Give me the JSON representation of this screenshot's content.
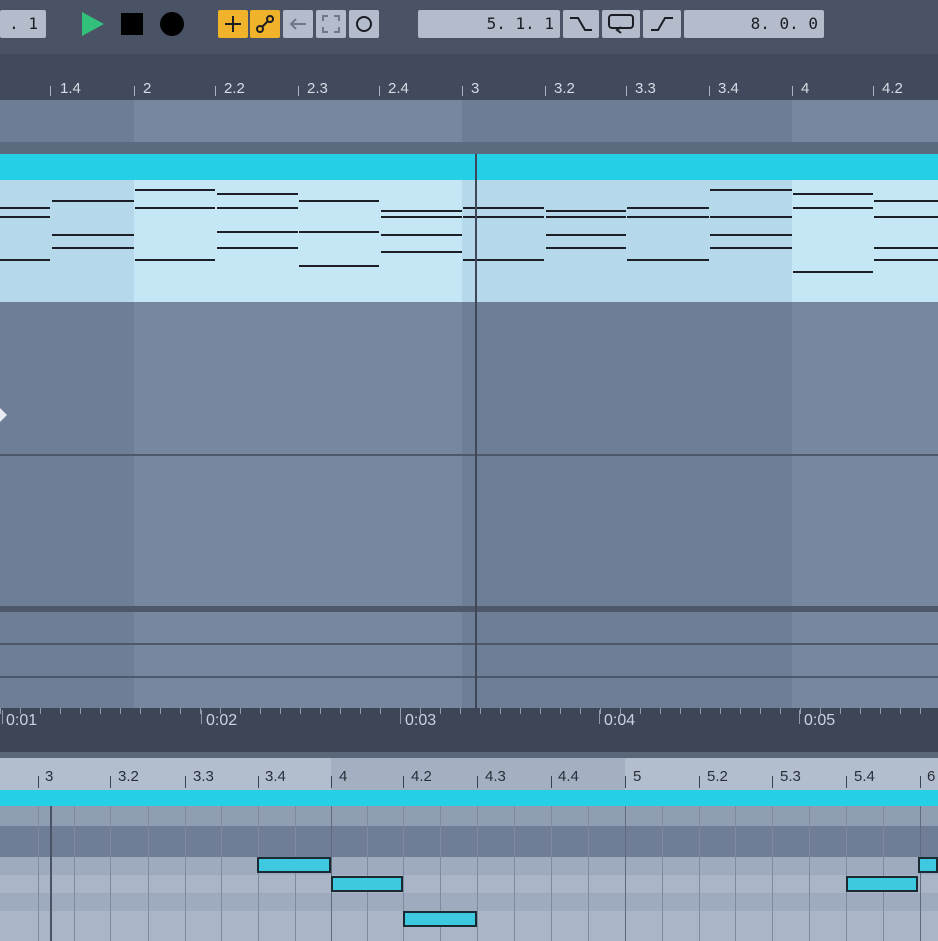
{
  "transport": {
    "left_lcd": ". 1",
    "position": "5.  1.  1",
    "loop_length": "8.  0.  0",
    "buttons": [
      "play",
      "stop",
      "record",
      "add",
      "link",
      "back-arrow",
      "fit",
      "circle"
    ]
  },
  "bar_ruler": {
    "labels": [
      "1.4",
      "2",
      "2.2",
      "2.3",
      "2.4",
      "3",
      "3.2",
      "3.3",
      "3.4",
      "4",
      "4.2"
    ]
  },
  "time_ruler": {
    "labels": [
      "0:01",
      "0:02",
      "0:03",
      "0:04",
      "0:05"
    ]
  },
  "bottom_ruler": {
    "labels": [
      "3",
      "3.2",
      "3.3",
      "3.4",
      "4",
      "4.2",
      "4.3",
      "4.4",
      "5",
      "5.2",
      "5.3",
      "5.4",
      "6"
    ]
  },
  "colors": {
    "clip": "#25d0e6",
    "accent_buttons": "#f0b22a",
    "play": "#33c07a"
  }
}
